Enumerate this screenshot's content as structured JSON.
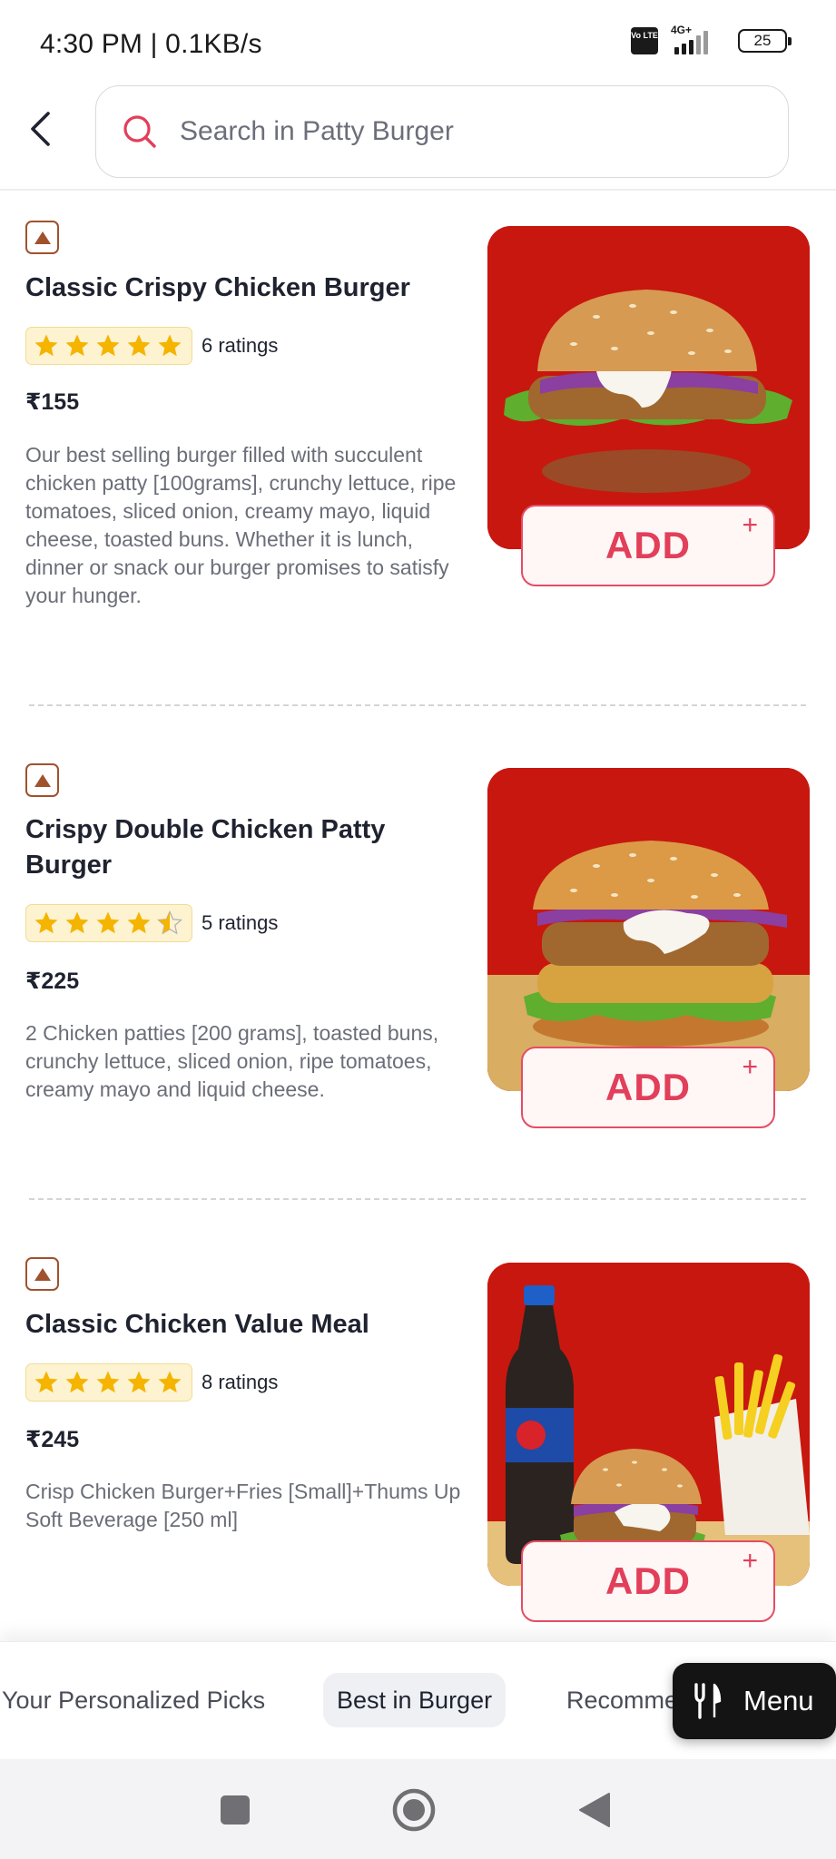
{
  "status_bar": {
    "time": "4:30 PM | 0.1KB/s",
    "volte_label": "Vo LTE",
    "network": "4G+",
    "battery": "25"
  },
  "header": {
    "back_icon": "chevron-left-icon",
    "search_icon": "search-icon",
    "search_placeholder": "Search in Patty Burger"
  },
  "items": [
    {
      "name": "Classic Crispy Chicken Burger",
      "rating_stars": 5,
      "rating_count": "6 ratings",
      "price": "₹155",
      "description": "Our best selling burger filled with succulent chicken patty [100grams], crunchy lettuce, ripe tomatoes, sliced onion, creamy mayo, liquid cheese, toasted buns. Whether it is lunch, dinner or snack our burger promises to satisfy your hunger.",
      "add_label": "ADD",
      "add_plus": "+"
    },
    {
      "name": "Crispy Double Chicken Patty Burger",
      "rating_stars": 4.5,
      "rating_count": "5 ratings",
      "price": "₹225",
      "description": "2 Chicken patties [200 grams], toasted buns, crunchy lettuce, sliced onion, ripe tomatoes, creamy mayo and liquid cheese.",
      "add_label": "ADD",
      "add_plus": "+"
    },
    {
      "name": "Classic Chicken Value Meal",
      "rating_stars": 5,
      "rating_count": "8 ratings",
      "price": "₹245",
      "description": "Crisp Chicken Burger+Fries [Small]+Thums Up Soft Beverage [250 ml]",
      "add_label": "ADD",
      "add_plus": "+"
    }
  ],
  "category_bar": {
    "tabs": [
      {
        "label": "Your Personalized Picks",
        "active": false
      },
      {
        "label": "Best in Burger",
        "active": true
      },
      {
        "label": "Recomme",
        "active": false
      }
    ],
    "menu_button": "Menu",
    "menu_icon": "fork-knife-icon"
  },
  "nav_bar": {
    "icons": [
      "recents-square-icon",
      "home-circle-icon",
      "back-triangle-icon"
    ]
  },
  "colors": {
    "accent": "#e23f5a",
    "image_bg": "#c8170f",
    "star": "#f5b400",
    "veg_badge": "#a0522d"
  }
}
